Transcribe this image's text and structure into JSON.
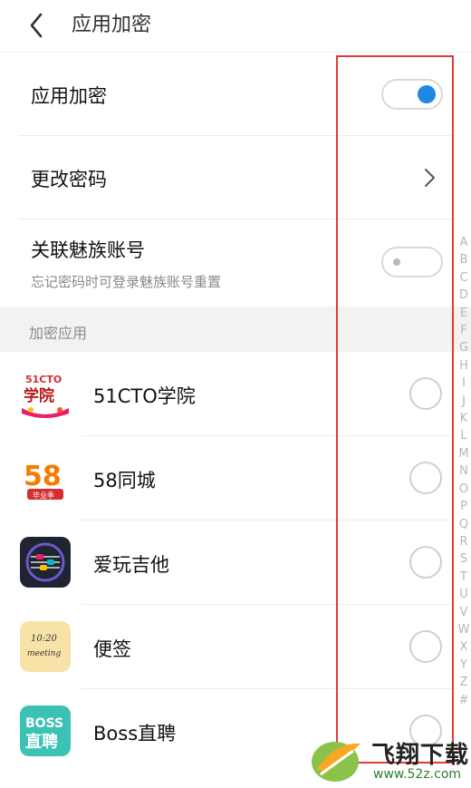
{
  "header": {
    "title": "应用加密",
    "back_icon": "chevron-left-icon"
  },
  "settings": {
    "app_lock": {
      "label": "应用加密",
      "enabled": true
    },
    "change_password": {
      "label": "更改密码"
    },
    "link_account": {
      "label": "关联魅族账号",
      "sublabel": "忘记密码时可登录魅族账号重置",
      "enabled": false
    }
  },
  "section": {
    "title": "加密应用"
  },
  "apps": [
    {
      "name": "51CTO学院",
      "icon": "51cto-app-icon",
      "icon_text_top": "51CTO",
      "icon_text_main": "学院",
      "selected": false
    },
    {
      "name": "58同城",
      "icon": "58-app-icon",
      "icon_text_main": "58",
      "icon_text_badge": "毕业季",
      "selected": false
    },
    {
      "name": "爱玩吉他",
      "icon": "guitar-app-icon",
      "selected": false
    },
    {
      "name": "便签",
      "icon": "notes-app-icon",
      "icon_text_top": "10:20",
      "icon_text_main": "meeting",
      "selected": false
    },
    {
      "name": "Boss直聘",
      "icon": "boss-app-icon",
      "icon_text_top": "BOSS",
      "icon_text_main": "直聘",
      "selected": false
    }
  ],
  "index_letters": [
    "A",
    "B",
    "C",
    "D",
    "E",
    "F",
    "G",
    "H",
    "I",
    "J",
    "K",
    "L",
    "M",
    "N",
    "O",
    "P",
    "Q",
    "R",
    "S",
    "T",
    "U",
    "V",
    "W",
    "X",
    "Y",
    "Z",
    "#"
  ],
  "watermark": {
    "title": "飞翔下载",
    "url": "www.52z.com"
  },
  "colors": {
    "accent": "#1e88e5",
    "highlight_box": "#e53935",
    "brand_green": "#2e7d32"
  }
}
